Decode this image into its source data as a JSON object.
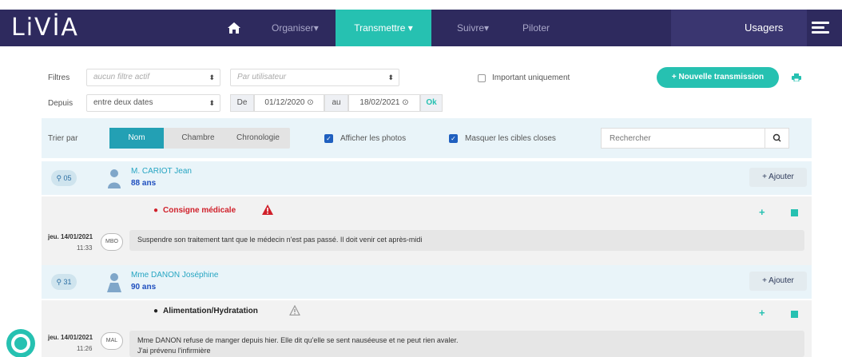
{
  "app": {
    "logo": "LiVİA"
  },
  "nav": {
    "items": [
      "Organiser▾",
      "Transmettre ▾",
      "Suivre▾",
      "Piloter"
    ],
    "usagers": "Usagers"
  },
  "filters": {
    "filtres_label": "Filtres",
    "filtre_select": "aucun filtre actif",
    "user_placeholder": "Par utilisateur",
    "important_label": "Important uniquement",
    "depuis_label": "Depuis",
    "depuis_select": "entre deux dates",
    "de_label": "De",
    "date_from": "01/12/2020 ⊙",
    "au_label": "au",
    "date_to": "18/02/2021 ⊙",
    "ok_label": "Ok",
    "new_button": "+ Nouvelle transmission"
  },
  "sort": {
    "label": "Trier par",
    "tabs": [
      "Nom",
      "Chambre",
      "Chronologie"
    ],
    "show_photos": "Afficher les photos",
    "hide_closed": "Masquer les cibles closes",
    "search_placeholder": "Rechercher"
  },
  "patients": [
    {
      "room": "⚲ 05",
      "name": "M. CARIOT Jean",
      "age": "88 ans",
      "add": "+ Ajouter",
      "target": "Consigne médicale",
      "target_color": "#d0202a",
      "date": "jeu. 14/01/2021",
      "time": "11:33",
      "author": "MBO",
      "message": "Suspendre son traitement tant que le médecin n'est pas passé. Il doit venir cet après-midi"
    },
    {
      "room": "⚲ 31",
      "name": "Mme DANON Joséphine",
      "age": "90 ans",
      "add": "+ Ajouter",
      "target": "Alimentation/Hydratation",
      "target_color": "#222222",
      "date": "jeu. 14/01/2021",
      "time": "11:26",
      "author": "MAL",
      "message": "Mme DANON refuse de manger depuis hier. Elle dit qu'elle se sent nauséeuse et ne peut rien avaler.",
      "message2": "J'ai prévenu l'infirmière"
    }
  ],
  "colors": {
    "navy": "#2e2a5e",
    "teal": "#26c1b1",
    "blue": "#1f4fbf"
  }
}
